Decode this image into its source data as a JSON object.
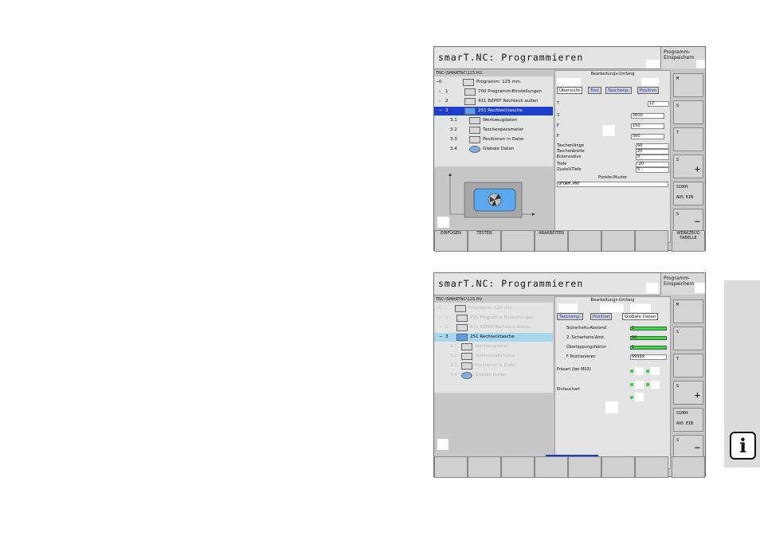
{
  "screen1": {
    "title": "smarT.NC: Programmieren",
    "top_right_label": "Programm-\nEinspeichern",
    "path": "TNC:\\SMARTNC\\123.HU",
    "panel_header": "Bearbeitungs-Umfang",
    "tabs": [
      "Übersicht",
      "Tool",
      "Taschenp.",
      "Position"
    ],
    "tree": [
      {
        "num": "0",
        "label": "Programm: 123 mm"
      },
      {
        "num": "1",
        "label": "700 Programm-Einstellungen"
      },
      {
        "num": "2",
        "label": "411 BZPKT Rechteck außen"
      },
      {
        "num": "3",
        "label": "251 Rechtecktasche"
      },
      {
        "num": "3.1",
        "label": "Werkzeugdaten"
      },
      {
        "num": "3.2",
        "label": "Taschenparameter"
      },
      {
        "num": "3.3",
        "label": "Positionen in Datei"
      },
      {
        "num": "3.4",
        "label": "Globale Daten"
      }
    ],
    "fields_top": [
      {
        "letter": "T",
        "value": "12"
      },
      {
        "letter": "S",
        "value": "3000"
      },
      {
        "letter": "F",
        "value": "150"
      },
      {
        "letter": "F",
        "value": "500"
      }
    ],
    "fields": [
      {
        "label": "Taschenlänge",
        "value": "60"
      },
      {
        "label": "Taschenbreite",
        "value": "20"
      },
      {
        "label": "Eckenradius",
        "value": "0"
      },
      {
        "label": "Tiefe",
        "value": "-20"
      },
      {
        "label": "Zustell-Tiefe",
        "value": "5"
      }
    ],
    "section_label": "Punkte-Muster",
    "pattern_value": "UFORM.PNT",
    "softkeys": [
      "EINFÜGEN",
      "TESTEN",
      "",
      "ABARBEITEN",
      "",
      "",
      "",
      "WERKZEUG\nTABELLE"
    ],
    "right_buttons": [
      {
        "label": "M"
      },
      {
        "label": "S"
      },
      {
        "label": "T"
      },
      {
        "label": "S"
      },
      {
        "label": "S100%",
        "sub": "AUS  EIN"
      },
      {
        "label": "S"
      }
    ]
  },
  "screen2": {
    "title": "smarT.NC: Programmieren",
    "top_right_label": "Programm-\nEinspeichern",
    "path": "TNC:\\SMARTNC\\123.HU",
    "panel_header": "Bearbeitungs-Umfang",
    "tabs": [
      "Taschenp.",
      "Position",
      "Globale Daten"
    ],
    "tree": [
      {
        "num": "0",
        "label": "Programm: 123 mm"
      },
      {
        "num": "1",
        "label": "700 Programm-Einstellungen"
      },
      {
        "num": "2",
        "label": "411 BZPKT Rechteck außen"
      },
      {
        "num": "3",
        "label": "251 Rechtecktasche"
      },
      {
        "num": "3.1",
        "label": "Werkzeugdaten"
      },
      {
        "num": "3.2",
        "label": "Taschenparameter"
      },
      {
        "num": "3.3",
        "label": "Positionen in Datei"
      },
      {
        "num": "3.4",
        "label": "Globale Daten"
      }
    ],
    "global_fields": [
      {
        "label": "Sicherheits-Abstand",
        "value": "2"
      },
      {
        "label": "2. Sicherheits-Abst.",
        "value": "50"
      },
      {
        "label": "Überlappungsfaktor",
        "value": "1"
      },
      {
        "label": "F Positionieren",
        "value": "99999"
      }
    ],
    "fraesart_label": "Fräsart (bei M03)",
    "eintauch_label": "Eintauchart",
    "right_buttons": [
      {
        "label": "M"
      },
      {
        "label": "S"
      },
      {
        "label": "T"
      },
      {
        "label": "S"
      },
      {
        "label": "S100%",
        "sub": "AUS  EIN"
      },
      {
        "label": "S"
      }
    ]
  },
  "info_icon_letter": "i",
  "colors": {
    "selected_row": "#1d3fd0",
    "highlight_row": "#a8d8ee",
    "green_bar": "#2ee03a",
    "panel_bg": "#c7c7c7"
  }
}
